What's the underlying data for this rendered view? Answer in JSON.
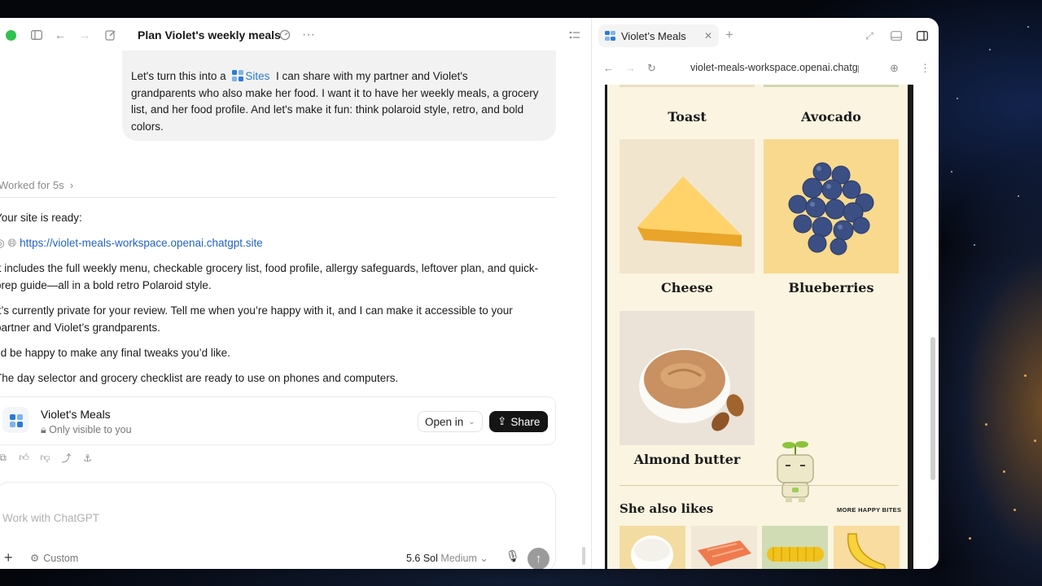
{
  "app": {
    "chat_title": "Plan Violet's weekly meals"
  },
  "chat": {
    "user_message": {
      "line1_before": "Let's turn this into a",
      "sites_label": "Sites",
      "line1_after": "I can share with my partner and Violet's",
      "line2": "grandparents who also make her food. I want it to have her weekly meals, a grocery",
      "line3": "list, and her food profile. And let's make it fun: think polaroid style, retro, and bold",
      "line4": "colors."
    },
    "worked_for": "Worked for 5s",
    "reply": {
      "ready": "Your site is ready:",
      "url": "https://violet-meals-workspace.openai.chatgpt.site",
      "p1_line1": "It includes the full weekly menu, checkable grocery list, food profile, allergy safeguards, leftover plan, and quick-",
      "p1_line2": "prep guide—all in a bold retro Polaroid style.",
      "p2_line1": "It’s currently private for your review. Tell me when you’re happy with it, and I can make it accessible to your",
      "p2_line2": "partner and Violet’s grandparents.",
      "p3": "I’d be happy to make any final tweaks you’d like.",
      "p4": "The day selector and grocery checklist are ready to use on phones and computers."
    },
    "site_card": {
      "title": "Violet's Meals",
      "visibility": "Only visible to you",
      "open_in_label": "Open in",
      "share_label": "Share"
    },
    "composer": {
      "placeholder": "Work with ChatGPT",
      "custom_label": "Custom",
      "model_label": "5.6 Sol",
      "effort_label": "Medium"
    }
  },
  "browser": {
    "tab_title": "Violet’s Meals",
    "url": "violet-meals-workspace.openai.chatgpt.site",
    "site": {
      "foods": [
        {
          "name": "Toast"
        },
        {
          "name": "Avocado"
        },
        {
          "name": "Cheese"
        },
        {
          "name": "Blueberries"
        },
        {
          "name": "Almond butter"
        }
      ],
      "section_title": "She also likes",
      "more_link": "MORE HAPPY BITES"
    }
  },
  "colors": {
    "accent_green": "#2fc24f",
    "link_blue": "#2463c4",
    "site_bg": "#fbf4e0",
    "share_button": "#151515"
  }
}
